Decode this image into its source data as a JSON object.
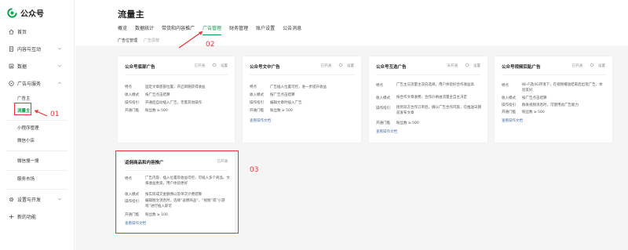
{
  "app": {
    "title": "公众号"
  },
  "sidebar": {
    "home": "首页",
    "content": "内容与互动",
    "data": "数据",
    "ads": "广告与服务",
    "ads_items": [
      "广告主",
      "流量主"
    ],
    "mini_items": [
      "小程序管理",
      "微信小店"
    ],
    "wechat_search": "微信搜一搜",
    "service_market": "服务市场",
    "settings": "设置与开发",
    "new_feature": "新的功能"
  },
  "header": {
    "title": "流量主",
    "tabs": [
      "概览",
      "数据统计",
      "带货和内容推广",
      "广告管理",
      "财务管理",
      "账户设置",
      "公告消息"
    ],
    "subtabs": [
      "广告位管理",
      "广告屏蔽"
    ]
  },
  "cards": [
    {
      "title": "公众号底部广告",
      "status": "已开通",
      "settings": "设置",
      "rows": [
        {
          "label": "特点",
          "value": "固定文章底部位置，开启即随获得收益"
        },
        {
          "label": "收入模式",
          "value": "按广告点击结算"
        },
        {
          "label": "操作指引",
          "value": "开通后自动插入广告，无需其他操作"
        },
        {
          "label": "开通门槛",
          "value": "粉丝数 ≥ 500"
        }
      ],
      "link": ""
    },
    {
      "title": "公众号文中广告",
      "status": "已开通",
      "settings": "设置",
      "rows": [
        {
          "label": "特点",
          "value": "广告插入位置可控，进一步提升收益"
        },
        {
          "label": "收入模式",
          "value": "按广告点击结算"
        },
        {
          "label": "操作指引",
          "value": "编辑文章时插入广告"
        },
        {
          "label": "开通门槛",
          "value": "粉丝数 ≥ 500"
        }
      ],
      "link": "查看操作文档"
    },
    {
      "title": "公众号互选广告",
      "status": "未开通",
      "settings": "设置",
      "rows": [
        {
          "label": "特点",
          "value": "广告主与流量主双向选择，用户体验好合作收益高"
        },
        {
          "label": "收入模式",
          "value": "按合作文章收费，合作价格由流量主自主决定"
        },
        {
          "label": "操作指引",
          "value": "接到双方合作订单后，确认广告合作内容，在推送日期前发布文章"
        },
        {
          "label": "开通门槛",
          "value": "粉丝数 ≥ 500"
        }
      ],
      "link": "查看操作文档"
    },
    {
      "title": "公众号视频后贴广告",
      "status": "已开通",
      "settings": "设置",
      "rows": [
        {
          "label": "特点",
          "value": "Wi-Fi及4G环境下，在视频播放结束后出现广告，体验友好"
        },
        {
          "label": "收入模式",
          "value": "按广告点击结算"
        },
        {
          "label": "操作指引",
          "value": "群发视频消息时，可使用此广告能力"
        },
        {
          "label": "开通门槛",
          "value": "粉丝数 ≥ 500"
        }
      ],
      "link": "查看操作文档"
    },
    {
      "title": "返佣商品和内容推广",
      "status": "已开通",
      "settings": "",
      "rows": [
        {
          "label": "特点",
          "value": "广告内容、插入位置及收益可控，可插入多个商品、文章收益更高，用户体验更好"
        },
        {
          "label": "收入模式",
          "value": "按实际成交金额佣以及单次计费结算"
        },
        {
          "label": "操作指引",
          "value": "编辑图文消息时，选择“返佣商品”、“视频”或“小游戏”进行插入即可"
        },
        {
          "label": "开通门槛",
          "value": "粉丝数 ≥ 100"
        }
      ],
      "link": "查看操作文档"
    }
  ],
  "annotations": [
    "01",
    "02",
    "03"
  ],
  "colors": {
    "accent": "#07a14a",
    "annotation": "#e33333",
    "link": "#4a6fa5"
  }
}
